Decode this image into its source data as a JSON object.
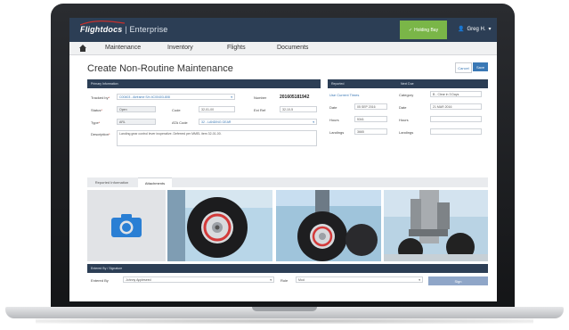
{
  "app": {
    "brand": "Flightdocs",
    "brand_sep": "|",
    "brand_sub": "Enterprise",
    "status_button": "Holding Bay",
    "user_name": "Greg H."
  },
  "nav": {
    "items": [
      "Maintenance",
      "Inventory",
      "Flights",
      "Documents"
    ]
  },
  "page": {
    "title": "Create Non-Routine Maintenance",
    "cancel_label": "Cancel",
    "save_label": "Save"
  },
  "primary_info": {
    "header": "Primary Information",
    "tracked_by_label": "Tracked by",
    "tracked_by_value": "C00403 - Airframe S/n 4C00403-808",
    "number_label": "Number",
    "number_value": "201605181942",
    "status_label": "Status",
    "status_value": "Open",
    "code_label": "Code",
    "code_value": "32-01-00",
    "ext_ref_label": "Ext Ref",
    "ext_ref_value": "32-10-5",
    "type_label": "Type",
    "type_value": "ARL",
    "ata_label": "ATA Code",
    "ata_value": "32 - LANDING GEAR",
    "description_label": "Description",
    "description_value": "Landing gear control lever inoperative. Deferred per MMEL item 32-01-00."
  },
  "reported": {
    "header": "Reported",
    "link": "Use Current Times",
    "date_label": "Date",
    "date_value": "05 SEP 2016",
    "hours_label": "Hours",
    "hours_value": "5341",
    "landings_label": "Landings",
    "landings_value": "3665"
  },
  "next_due": {
    "header": "Next Due",
    "category_label": "Category",
    "category_value": "B - Clear in 3 Days",
    "date_label": "Date",
    "date_value": "21 MAR 2016",
    "hours_label": "Hours",
    "hours_value": "",
    "landings_label": "Landings",
    "landings_value": ""
  },
  "tabs": [
    "Reported Information",
    "Attachments"
  ],
  "attachments": {
    "count": 4
  },
  "entered": {
    "header": "Entered By / Signature",
    "entered_by_label": "Entered By",
    "entered_by_value": "Johnny Appleseed",
    "role_label": "Role",
    "role_value": "Mod",
    "sign_label": "Sign"
  },
  "colors": {
    "header_navy": "#2c3e55",
    "accent_blue": "#3a78b5",
    "status_green": "#7ab648"
  }
}
